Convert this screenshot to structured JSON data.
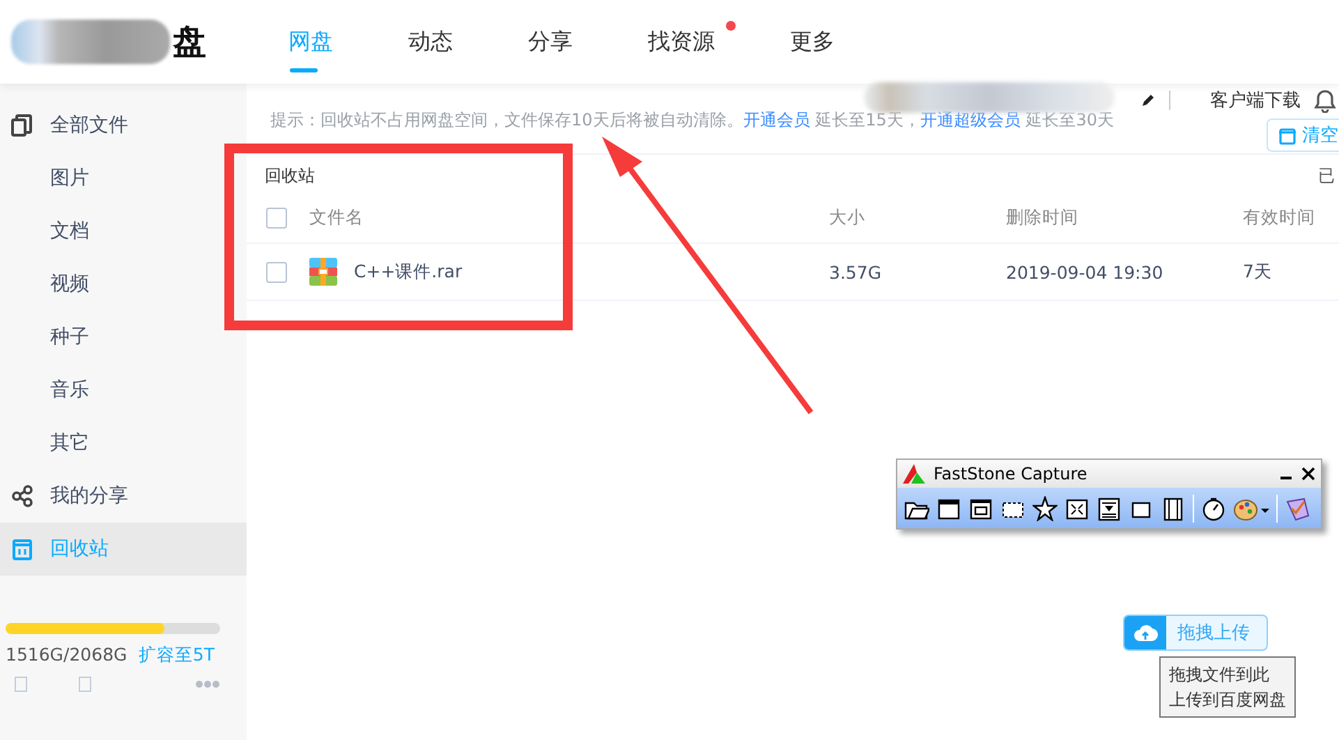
{
  "header": {
    "logo_char": "盘",
    "tabs": [
      {
        "label": "网盘",
        "selected": true,
        "dot": false
      },
      {
        "label": "动态",
        "selected": false,
        "dot": false
      },
      {
        "label": "分享",
        "selected": false,
        "dot": false
      },
      {
        "label": "找资源",
        "selected": false,
        "dot": true
      },
      {
        "label": "更多",
        "selected": false,
        "dot": false
      }
    ]
  },
  "sidebar": {
    "items": [
      {
        "label": "全部文件",
        "kind": "files",
        "selected": false
      },
      {
        "label": "图片",
        "selected": false
      },
      {
        "label": "文档",
        "selected": false
      },
      {
        "label": "视频",
        "selected": false
      },
      {
        "label": "种子",
        "selected": false
      },
      {
        "label": "音乐",
        "selected": false
      },
      {
        "label": "其它",
        "selected": false
      },
      {
        "label": "我的分享",
        "kind": "share",
        "selected": false
      },
      {
        "label": "回收站",
        "kind": "trash",
        "selected": true
      }
    ],
    "storage": {
      "level": 0.74,
      "usage": "1516G/2068G",
      "upgrade_link": "扩容至5T"
    }
  },
  "top_bar": {
    "client_download": "客户端下载",
    "clear_button": "清空"
  },
  "notice": [
    {
      "kind": "plain",
      "text": "提示：回收站不占用网盘空间，文件保存10天后将被自动清除。"
    },
    {
      "kind": "link",
      "text": "开通会员"
    },
    {
      "kind": "plain",
      "text": " 延长至15天，"
    },
    {
      "kind": "link",
      "text": "开通超级会员"
    },
    {
      "kind": "plain",
      "text": " 延长至30天"
    }
  ],
  "content": {
    "title": "回收站",
    "right_text": "已",
    "header_checked": false,
    "columns": [
      "文件名",
      "大小",
      "删除时间",
      "有效时间"
    ],
    "rows": [
      {
        "checked": false,
        "name": "C++课件.rar",
        "size": "3.57G",
        "deleted": "2019-09-04 19:30",
        "validity": "7天"
      }
    ]
  },
  "upload": {
    "button": "拖拽上传",
    "tooltip": [
      "拖拽文件到此",
      "上传到百度网盘"
    ]
  },
  "capture_window": {
    "title": "FastStone Capture"
  }
}
